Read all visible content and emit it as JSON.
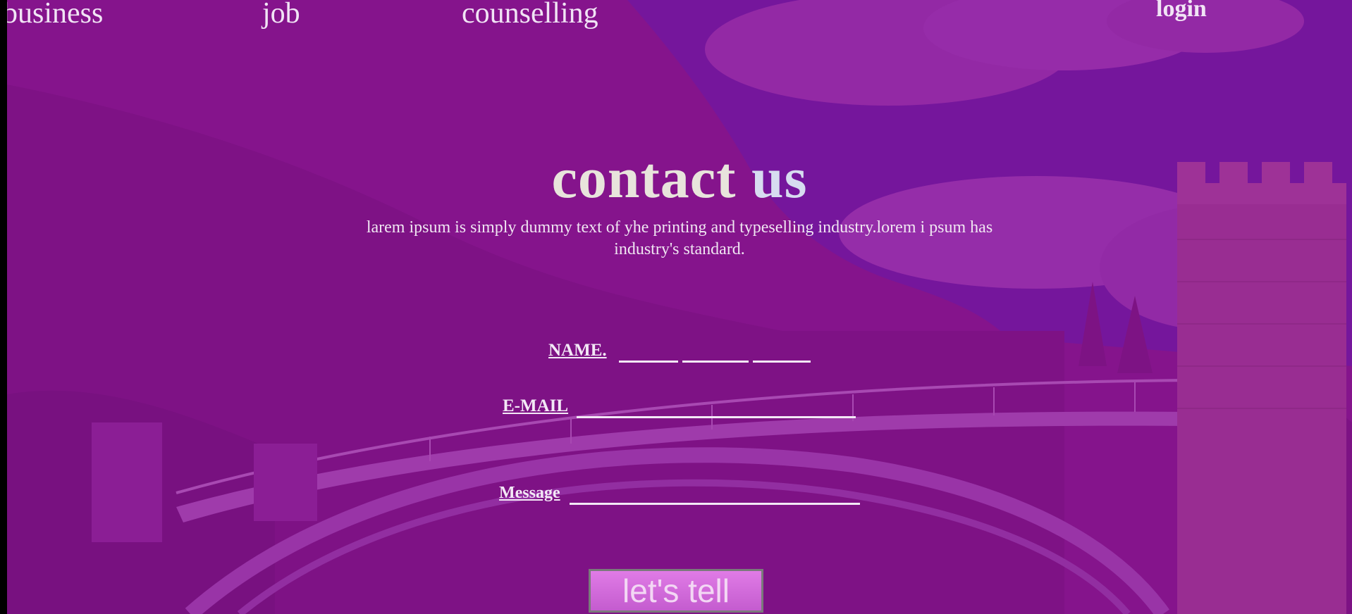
{
  "nav": {
    "items": [
      {
        "label": "business"
      },
      {
        "label": "job"
      },
      {
        "label": "counselling"
      }
    ],
    "login_label": "login"
  },
  "hero": {
    "title_part1": "contact",
    "title_part2": "us",
    "subtitle": "larem ipsum is simply dummy text of yhe printing and typeselling industry.lorem i psum has industry's standard."
  },
  "form": {
    "name_label": "NAME.",
    "email_label": "E-MAIL",
    "message_label": "Message",
    "submit_label": "let's tell"
  },
  "colors": {
    "tint": "#8c1496",
    "sky": "#5b1fa8",
    "text": "#f1e4f5",
    "button": "#d46cda"
  }
}
